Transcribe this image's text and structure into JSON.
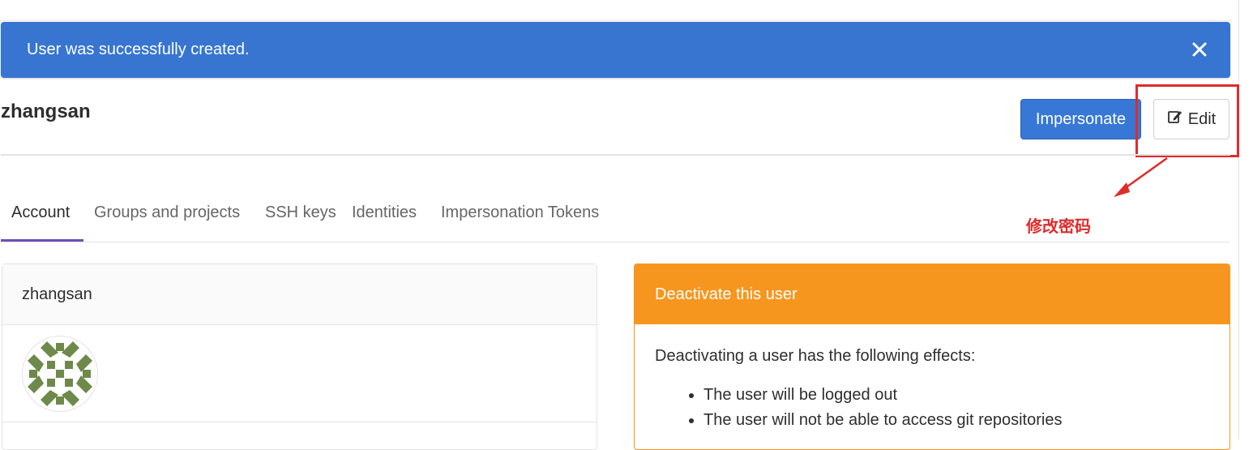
{
  "flash": {
    "message": "User was successfully created."
  },
  "user": {
    "username": "zhangsan"
  },
  "actions": {
    "impersonate_label": "Impersonate",
    "edit_label": "Edit"
  },
  "annotation": {
    "text": "修改密码",
    "color": "#e02b2b"
  },
  "tabs": [
    {
      "label": "Account",
      "active": true
    },
    {
      "label": "Groups and projects"
    },
    {
      "label": "SSH keys"
    },
    {
      "label": "Identities"
    },
    {
      "label": "Impersonation Tokens"
    }
  ],
  "user_card": {
    "header": "zhangsan",
    "avatar_icon": "identicon-green"
  },
  "deactivate": {
    "header": "Deactivate this user",
    "intro": "Deactivating a user has the following effects:",
    "effects": [
      "The user will be logged out",
      "The user will not be able to access git repositories"
    ]
  },
  "colors": {
    "flash_bg": "#3775d1",
    "primary": "#3777d6",
    "warning": "#f7961f",
    "tab_active_underline": "#6b4fbb"
  }
}
